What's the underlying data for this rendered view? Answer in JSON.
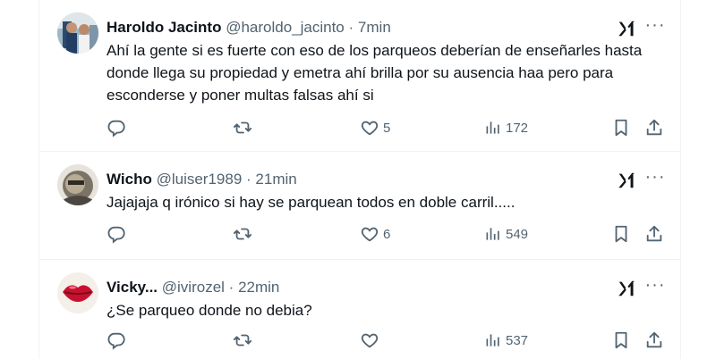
{
  "tweets": [
    {
      "name": "Haroldo Jacinto",
      "handle": "@haroldo_jacinto",
      "separator": "·",
      "time": "7min",
      "text": "Ahí la gente si es fuerte con eso de los parqueos deberían de enseñarles hasta donde llega su propiedad y emetra ahí brilla por su ausencia haa pero para esconderse y poner multas falsas ahí si",
      "likes": "5",
      "views": "172"
    },
    {
      "name": "Wicho",
      "handle": "@luiser1989",
      "separator": "·",
      "time": "21min",
      "text": "Jajajaja q irónico si hay se parquean todos en doble carril.....",
      "likes": "6",
      "views": "549"
    },
    {
      "name": "Vicky...",
      "handle": "@ivirozel",
      "separator": "·",
      "time": "22min",
      "text": "¿Se parqueo donde no debia?",
      "likes": "",
      "views": "537"
    }
  ],
  "more_label": "···",
  "icons": [
    "grok-icon",
    "more-icon",
    "reply-icon",
    "retweet-icon",
    "heart-icon",
    "views-icon",
    "bookmark-icon",
    "share-icon"
  ],
  "colors": {
    "text": "#0f1419",
    "secondary": "#536471",
    "border": "#eff3f4"
  }
}
